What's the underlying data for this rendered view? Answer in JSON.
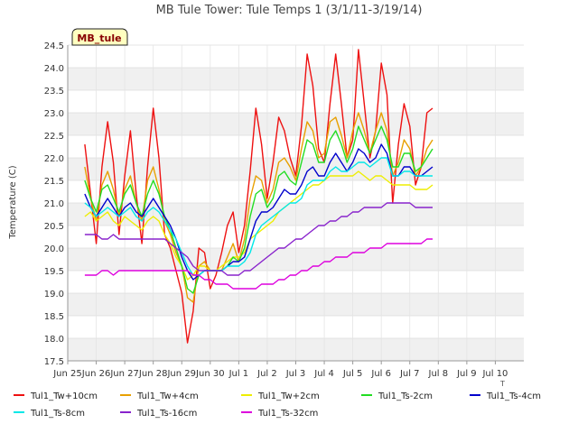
{
  "chart_data": {
    "type": "line",
    "title": "MB Tule Tower: Tule Temps 1 (3/1/11-3/19/14)",
    "ylabel": "Temperature (C)",
    "xlabel": "",
    "station_badge": "MB_tule",
    "axis_corner_label": "T",
    "ylim": [
      17.5,
      24.5
    ],
    "yticks": [
      "17.5",
      "18.0",
      "18.5",
      "19.0",
      "19.5",
      "20.0",
      "20.5",
      "21.0",
      "21.5",
      "22.0",
      "22.5",
      "23.0",
      "23.5",
      "24.0",
      "24.5"
    ],
    "xlim": [
      0,
      16
    ],
    "xticks": [
      {
        "x": 0,
        "label": "Jun 25"
      },
      {
        "x": 1,
        "label": "Jun 26"
      },
      {
        "x": 2,
        "label": "Jun 27"
      },
      {
        "x": 3,
        "label": "Jun 28"
      },
      {
        "x": 4,
        "label": "Jun 29"
      },
      {
        "x": 5,
        "label": "Jun 30"
      },
      {
        "x": 6,
        "label": "Jul 1"
      },
      {
        "x": 7,
        "label": "Jul 2"
      },
      {
        "x": 8,
        "label": "Jul 3"
      },
      {
        "x": 9,
        "label": "Jul 4"
      },
      {
        "x": 10,
        "label": "Jul 5"
      },
      {
        "x": 11,
        "label": "Jul 6"
      },
      {
        "x": 12,
        "label": "Jul 7"
      },
      {
        "x": 13,
        "label": "Jul 8"
      },
      {
        "x": 14,
        "label": "Jul 9"
      },
      {
        "x": 15,
        "label": "Jul 10"
      }
    ],
    "grid": true,
    "legend_position": "bottom",
    "x": [
      0.6,
      0.8,
      1.0,
      1.2,
      1.4,
      1.6,
      1.8,
      2.0,
      2.2,
      2.4,
      2.6,
      2.8,
      3.0,
      3.2,
      3.4,
      3.6,
      3.8,
      4.0,
      4.2,
      4.4,
      4.6,
      4.8,
      5.0,
      5.2,
      5.4,
      5.6,
      5.8,
      6.0,
      6.2,
      6.4,
      6.6,
      6.8,
      7.0,
      7.2,
      7.4,
      7.6,
      7.8,
      8.0,
      8.2,
      8.4,
      8.6,
      8.8,
      9.0,
      9.2,
      9.4,
      9.6,
      9.8,
      10.0,
      10.2,
      10.4,
      10.6,
      10.8,
      11.0,
      11.2,
      11.4,
      11.6,
      11.8,
      12.0,
      12.2,
      12.4,
      12.6,
      12.8,
      13.0,
      13.2,
      13.4,
      13.6,
      13.8,
      14.0,
      14.2,
      14.4
    ],
    "series": [
      {
        "name": "Tul1_Tw+10cm",
        "color": "#ee1111",
        "values": [
          22.3,
          21.2,
          20.1,
          21.8,
          22.8,
          21.9,
          20.3,
          21.6,
          22.6,
          21.2,
          20.1,
          21.8,
          23.1,
          22.0,
          20.3,
          20.0,
          19.5,
          19.0,
          17.9,
          18.6,
          20.0,
          19.9,
          19.1,
          19.4,
          19.9,
          20.5,
          20.8,
          19.9,
          20.5,
          21.7,
          23.1,
          22.3,
          21.1,
          21.9,
          22.9,
          22.6,
          22.0,
          21.6,
          22.7,
          24.3,
          23.6,
          22.2,
          21.9,
          23.2,
          24.3,
          23.2,
          22.0,
          22.4,
          24.4,
          23.2,
          22.0,
          22.6,
          24.1,
          23.4,
          21.0,
          22.3,
          23.2,
          22.7,
          21.4,
          21.8,
          23.0,
          23.1
        ]
      },
      {
        "name": "Tul1_Tw+4cm",
        "color": "#e8a000",
        "values": [
          21.8,
          21.1,
          20.6,
          21.4,
          21.7,
          21.3,
          20.7,
          21.3,
          21.6,
          21.0,
          20.6,
          21.5,
          21.8,
          21.3,
          20.6,
          20.3,
          19.9,
          19.6,
          18.9,
          18.8,
          19.6,
          19.7,
          19.5,
          19.5,
          19.5,
          19.8,
          20.1,
          19.7,
          20.2,
          21.1,
          21.6,
          21.5,
          21.0,
          21.3,
          21.9,
          22.0,
          21.8,
          21.5,
          22.2,
          22.8,
          22.6,
          22.0,
          22.1,
          22.8,
          22.9,
          22.5,
          22.0,
          22.6,
          23.0,
          22.6,
          22.1,
          22.6,
          23.0,
          22.6,
          21.6,
          21.9,
          22.4,
          22.2,
          21.6,
          21.8,
          22.2,
          22.4
        ]
      },
      {
        "name": "Tul1_Tw+2cm",
        "color": "#eeee00",
        "values": [
          20.7,
          20.8,
          20.6,
          20.7,
          20.8,
          20.6,
          20.5,
          20.7,
          20.6,
          20.5,
          20.4,
          20.6,
          20.7,
          20.6,
          20.3,
          20.1,
          19.8,
          19.6,
          19.3,
          19.4,
          19.6,
          19.6,
          19.5,
          19.5,
          19.6,
          19.7,
          19.8,
          19.8,
          19.9,
          20.2,
          20.3,
          20.4,
          20.5,
          20.6,
          20.8,
          20.9,
          21.0,
          21.1,
          21.2,
          21.3,
          21.4,
          21.4,
          21.5,
          21.6,
          21.6,
          21.6,
          21.6,
          21.6,
          21.7,
          21.6,
          21.5,
          21.6,
          21.6,
          21.5,
          21.4,
          21.4,
          21.4,
          21.4,
          21.3,
          21.3,
          21.3,
          21.4
        ]
      },
      {
        "name": "Tul1_Ts-2cm",
        "color": "#22dd22",
        "values": [
          21.5,
          21.1,
          20.8,
          21.3,
          21.4,
          21.1,
          20.8,
          21.2,
          21.4,
          21.0,
          20.7,
          21.2,
          21.5,
          21.2,
          20.7,
          20.4,
          20.0,
          19.6,
          19.1,
          19.0,
          19.4,
          19.5,
          19.5,
          19.5,
          19.5,
          19.6,
          19.8,
          19.7,
          20.0,
          20.7,
          21.2,
          21.3,
          20.9,
          21.1,
          21.6,
          21.7,
          21.5,
          21.4,
          21.9,
          22.4,
          22.3,
          21.9,
          21.9,
          22.4,
          22.6,
          22.3,
          21.9,
          22.2,
          22.7,
          22.4,
          22.1,
          22.4,
          22.7,
          22.4,
          21.8,
          21.8,
          22.1,
          22.1,
          21.7,
          21.8,
          22.0,
          22.2
        ]
      },
      {
        "name": "Tul1_Ts-4cm",
        "color": "#0000cc",
        "values": [
          21.2,
          20.9,
          20.7,
          20.9,
          21.1,
          20.9,
          20.7,
          20.9,
          21.0,
          20.8,
          20.7,
          20.9,
          21.1,
          20.9,
          20.7,
          20.5,
          20.2,
          19.8,
          19.5,
          19.3,
          19.4,
          19.5,
          19.5,
          19.5,
          19.5,
          19.6,
          19.7,
          19.7,
          19.8,
          20.2,
          20.6,
          20.8,
          20.8,
          20.9,
          21.1,
          21.3,
          21.2,
          21.2,
          21.4,
          21.7,
          21.8,
          21.6,
          21.6,
          21.9,
          22.1,
          21.9,
          21.7,
          21.9,
          22.2,
          22.1,
          21.9,
          22.0,
          22.3,
          22.1,
          21.6,
          21.6,
          21.8,
          21.8,
          21.6,
          21.6,
          21.7,
          21.8
        ]
      },
      {
        "name": "Tul1_Ts-8cm",
        "color": "#00e8e8",
        "values": [
          21.0,
          20.9,
          20.7,
          20.8,
          20.9,
          20.8,
          20.7,
          20.8,
          20.9,
          20.7,
          20.6,
          20.8,
          20.9,
          20.8,
          20.6,
          20.4,
          20.2,
          19.9,
          19.6,
          19.4,
          19.4,
          19.5,
          19.5,
          19.5,
          19.5,
          19.6,
          19.6,
          19.6,
          19.7,
          19.9,
          20.3,
          20.5,
          20.6,
          20.7,
          20.8,
          20.9,
          21.0,
          21.0,
          21.1,
          21.4,
          21.5,
          21.5,
          21.5,
          21.7,
          21.8,
          21.7,
          21.7,
          21.8,
          21.9,
          21.9,
          21.8,
          21.9,
          22.0,
          22.0,
          21.6,
          21.6,
          21.7,
          21.7,
          21.6,
          21.6,
          21.6,
          21.6
        ]
      },
      {
        "name": "Tul1_Ts-16cm",
        "color": "#8822cc",
        "values": [
          20.3,
          20.3,
          20.3,
          20.2,
          20.2,
          20.3,
          20.2,
          20.2,
          20.2,
          20.2,
          20.2,
          20.2,
          20.2,
          20.2,
          20.2,
          20.1,
          20.0,
          19.9,
          19.8,
          19.6,
          19.5,
          19.5,
          19.5,
          19.5,
          19.5,
          19.4,
          19.4,
          19.4,
          19.5,
          19.5,
          19.6,
          19.7,
          19.8,
          19.9,
          20.0,
          20.0,
          20.1,
          20.2,
          20.2,
          20.3,
          20.4,
          20.5,
          20.5,
          20.6,
          20.6,
          20.7,
          20.7,
          20.8,
          20.8,
          20.9,
          20.9,
          20.9,
          20.9,
          21.0,
          21.0,
          21.0,
          21.0,
          21.0,
          20.9,
          20.9,
          20.9,
          20.9
        ]
      },
      {
        "name": "Tul1_Ts-32cm",
        "color": "#dd00dd",
        "values": [
          19.4,
          19.4,
          19.4,
          19.5,
          19.5,
          19.4,
          19.5,
          19.5,
          19.5,
          19.5,
          19.5,
          19.5,
          19.5,
          19.5,
          19.5,
          19.5,
          19.5,
          19.5,
          19.5,
          19.4,
          19.4,
          19.3,
          19.3,
          19.2,
          19.2,
          19.2,
          19.1,
          19.1,
          19.1,
          19.1,
          19.1,
          19.2,
          19.2,
          19.2,
          19.3,
          19.3,
          19.4,
          19.4,
          19.5,
          19.5,
          19.6,
          19.6,
          19.7,
          19.7,
          19.8,
          19.8,
          19.8,
          19.9,
          19.9,
          19.9,
          20.0,
          20.0,
          20.0,
          20.1,
          20.1,
          20.1,
          20.1,
          20.1,
          20.1,
          20.1,
          20.2,
          20.2
        ]
      }
    ]
  }
}
